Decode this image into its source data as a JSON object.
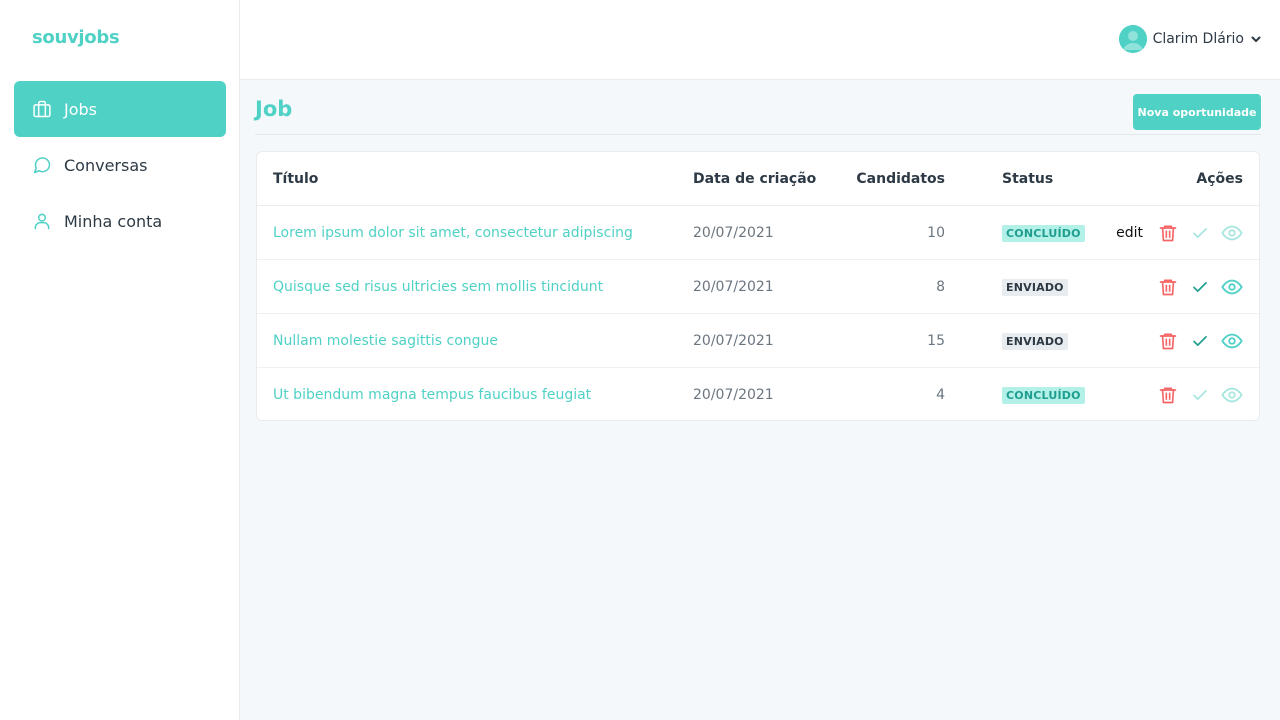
{
  "app": {
    "logo": "souvjobs"
  },
  "sidebar": {
    "items": [
      {
        "label": "Jobs",
        "icon": "briefcase-icon",
        "active": true
      },
      {
        "label": "Conversas",
        "icon": "chat-icon",
        "active": false
      },
      {
        "label": "Minha conta",
        "icon": "user-icon",
        "active": false
      }
    ]
  },
  "header": {
    "user_name": "Clarim Dlário",
    "avatar_icon": "avatar-icon",
    "chevron_icon": "chevron-down-icon"
  },
  "page": {
    "title": "Job",
    "new_button_label": "Nova oportunidade"
  },
  "table": {
    "columns": [
      "Título",
      "Data de criação",
      "Candidatos",
      "Status",
      "Ações"
    ],
    "rows": [
      {
        "title": "Lorem ipsum dolor sit amet, consectetur adipiscing",
        "date": "20/07/2021",
        "candidates": "10",
        "status": "CONCLUÍDO",
        "edit_label": "edit"
      },
      {
        "title": "Quisque sed risus ultricies sem mollis tincidunt",
        "date": "20/07/2021",
        "candidates": "8",
        "status": "ENVIADO",
        "edit_label": ""
      },
      {
        "title": "Nullam molestie sagittis congue",
        "date": "20/07/2021",
        "candidates": "15",
        "status": "ENVIADO",
        "edit_label": ""
      },
      {
        "title": "Ut bibendum magna tempus faucibus feugiat",
        "date": "20/07/2021",
        "candidates": "4",
        "status": "CONCLUÍDO",
        "edit_label": ""
      }
    ]
  },
  "colors": {
    "accent": "#4fd1c5",
    "danger": "#f56565",
    "check_active": "#1f9e90",
    "check_disabled": "#a8e6df",
    "text": "#2d3a45"
  }
}
